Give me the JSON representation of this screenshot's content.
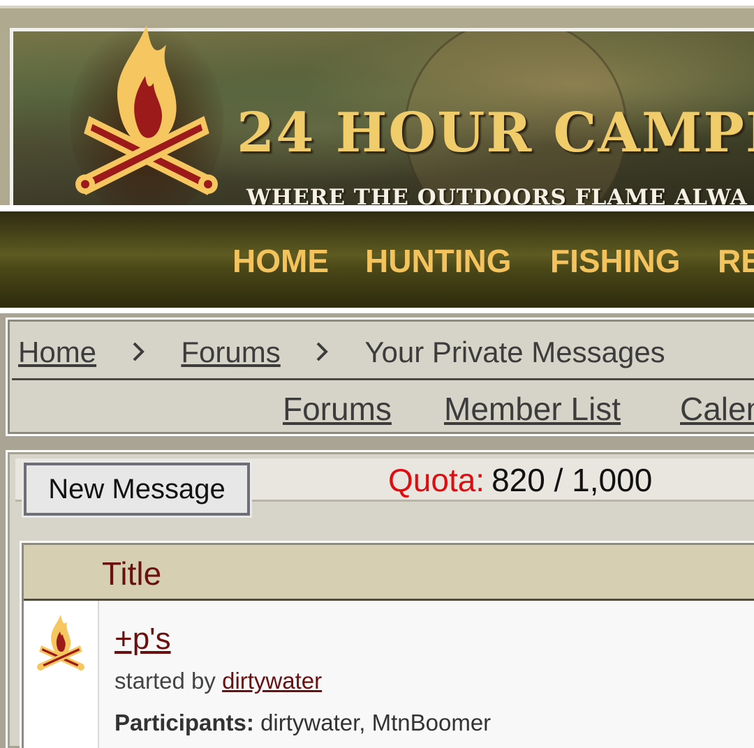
{
  "banner": {
    "title": "24 HOUR CAMPFI",
    "subtitle": "WHERE THE OUTDOORS FLAME ALWA"
  },
  "nav": {
    "items": [
      "HOME",
      "HUNTING",
      "FISHING",
      "RE"
    ]
  },
  "breadcrumb": {
    "home": "Home",
    "forums": "Forums",
    "current": "Your Private Messages"
  },
  "sublinks": {
    "forums": "Forums",
    "member_list": "Member List",
    "calendar": "Calen"
  },
  "toolbar": {
    "new_message_label": "New Message",
    "quota_label": "Quota:",
    "quota_value": "820 / 1,000"
  },
  "table": {
    "header_title": "Title",
    "rows": [
      {
        "title": "+p's",
        "started_by_prefix": "started by",
        "author": "dirtywater",
        "participants_label": "Participants:",
        "participants": "dirtywater, MtnBoomer"
      }
    ]
  },
  "colors": {
    "nav_text": "#f4c35d",
    "link_maroon": "#6a1010",
    "quota_red": "#e00d10",
    "banner_title": "#f1cc6b"
  }
}
